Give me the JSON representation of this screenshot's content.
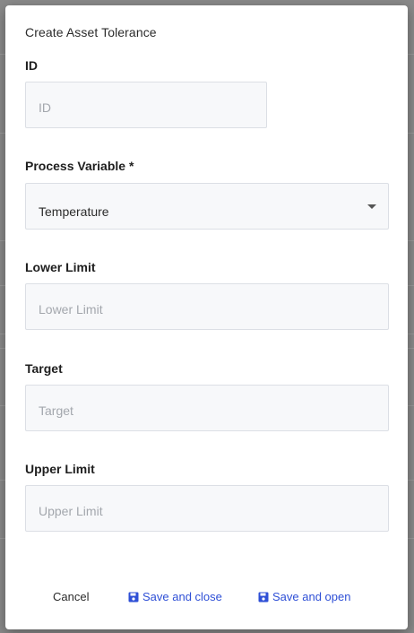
{
  "dialog": {
    "title": "Create Asset Tolerance"
  },
  "fields": {
    "id": {
      "label": "ID",
      "placeholder": "ID",
      "value": ""
    },
    "process_variable": {
      "label": "Process Variable *",
      "value": "Temperature"
    },
    "lower_limit": {
      "label": "Lower Limit",
      "placeholder": "Lower Limit",
      "value": ""
    },
    "target": {
      "label": "Target",
      "placeholder": "Target",
      "value": ""
    },
    "upper_limit": {
      "label": "Upper Limit",
      "placeholder": "Upper Limit",
      "value": ""
    }
  },
  "footer": {
    "cancel_label": "Cancel",
    "save_close_label": "Save and close",
    "save_open_label": "Save and open"
  },
  "icons": {
    "save": "floppy-disk-icon",
    "dropdown": "caret-down-icon"
  },
  "colors": {
    "accent": "#2e4fd6",
    "input_bg": "#f7f8fa",
    "input_border": "#dcdfe5"
  }
}
